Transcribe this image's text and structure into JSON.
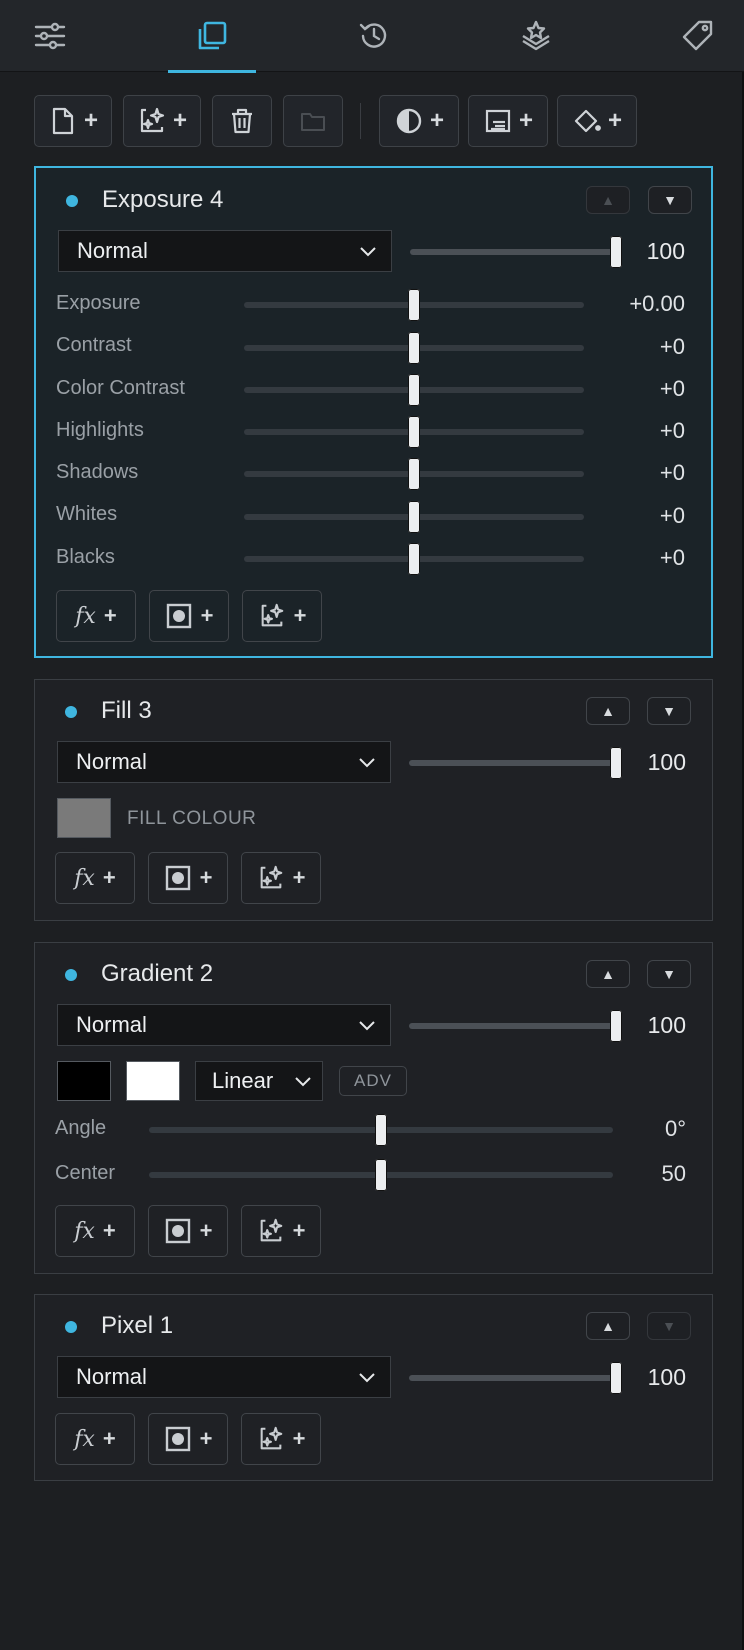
{
  "tabs": [
    {
      "name": "adjustments"
    },
    {
      "name": "layers",
      "active": true
    },
    {
      "name": "history"
    },
    {
      "name": "styles"
    },
    {
      "name": "tags"
    }
  ],
  "toolbar": {
    "buttons": [
      "new-layer",
      "ai-layer",
      "delete",
      "folder",
      "adjustment",
      "gradient",
      "fill"
    ]
  },
  "colors": {
    "accent": "#3fb6e0"
  },
  "layers": [
    {
      "title": "Exposure 4",
      "blend": "Normal",
      "opacity": "100",
      "up_disabled": true,
      "adjustments": [
        {
          "label": "Exposure",
          "value": "+0.00"
        },
        {
          "label": "Contrast",
          "value": "+0"
        },
        {
          "label": "Color Contrast",
          "value": "+0"
        },
        {
          "label": "Highlights",
          "value": "+0"
        },
        {
          "label": "Shadows",
          "value": "+0"
        },
        {
          "label": "Whites",
          "value": "+0"
        },
        {
          "label": "Blacks",
          "value": "+0"
        }
      ]
    },
    {
      "title": "Fill 3",
      "blend": "Normal",
      "opacity": "100",
      "fill_label": "FILL COLOUR",
      "fill_color": "#7a7a7a"
    },
    {
      "title": "Gradient 2",
      "blend": "Normal",
      "opacity": "100",
      "gradient_type": "Linear",
      "adv_label": "ADV",
      "stop_colors": [
        "#000000",
        "#ffffff"
      ],
      "adjustments": [
        {
          "label": "Angle",
          "value": "0°"
        },
        {
          "label": "Center",
          "value": "50"
        }
      ]
    },
    {
      "title": "Pixel 1",
      "blend": "Normal",
      "opacity": "100",
      "down_disabled": true
    }
  ],
  "fx_label": "fx",
  "plus": "+"
}
